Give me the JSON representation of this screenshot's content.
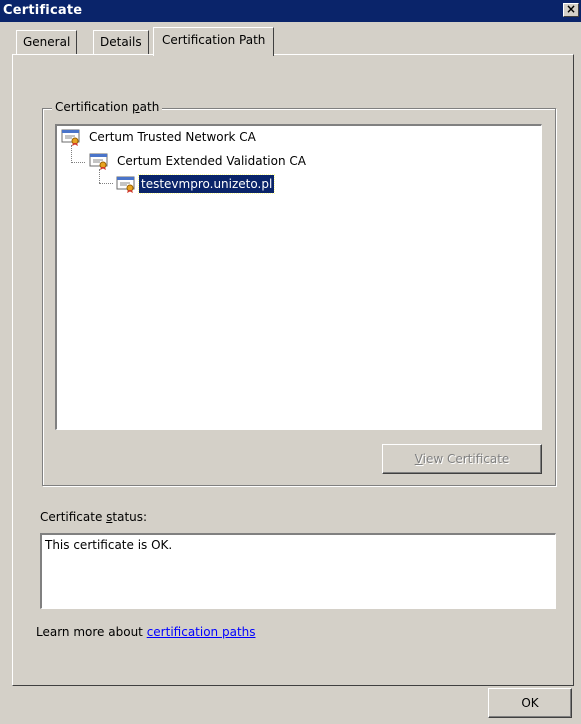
{
  "window": {
    "title": "Certificate",
    "close_glyph": "×"
  },
  "tabs": [
    {
      "label": "General"
    },
    {
      "label": "Details"
    },
    {
      "label": "Certification Path"
    }
  ],
  "path_group": {
    "label_pre": "Certification ",
    "label_mn": "p",
    "label_post": "ath",
    "items": [
      {
        "label": "Certum Trusted Network CA",
        "icon": "certificate-icon"
      },
      {
        "label": "Certum Extended Validation CA",
        "icon": "certificate-icon"
      },
      {
        "label": "testevmpro.unizeto.pl",
        "icon": "certificate-icon",
        "selected": true
      }
    ],
    "view_button_mn": "V",
    "view_button_post": "iew Certificate"
  },
  "status": {
    "label_pre": "Certificate ",
    "label_mn": "s",
    "label_post": "tatus:",
    "text": "This certificate is OK."
  },
  "learn_more": {
    "text": "Learn more about ",
    "link": "certification paths"
  },
  "ok_button": "OK",
  "colors": {
    "title_bar": "#0a246a",
    "face": "#d4d0c8",
    "selection": "#0a246a",
    "link": "#0000ff"
  }
}
